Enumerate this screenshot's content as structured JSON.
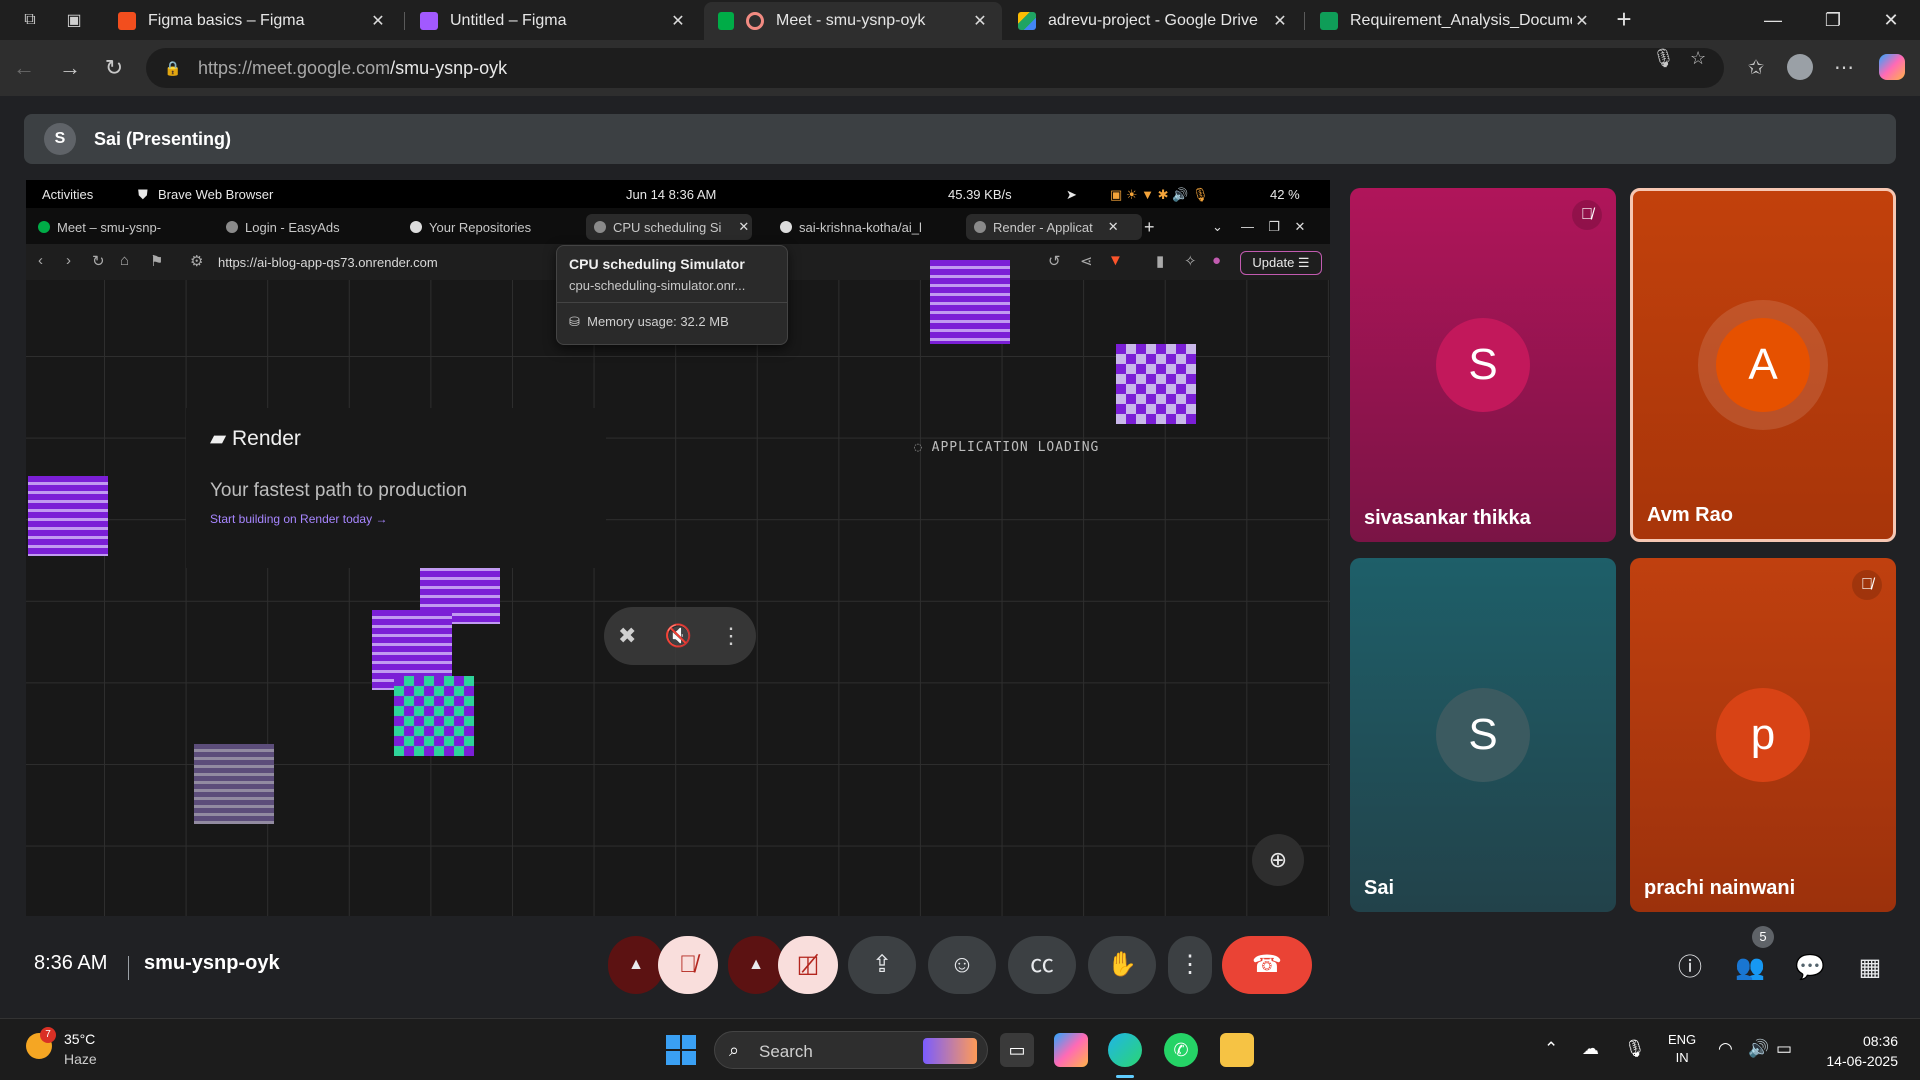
{
  "browser": {
    "tabs": [
      {
        "title": "Figma basics – Figma",
        "favicon": "figma-icon",
        "color": "#f24e1e"
      },
      {
        "title": "Untitled – Figma",
        "favicon": "figma-icon",
        "color": "#a259ff"
      },
      {
        "title": "Meet - smu-ysnp-oyk",
        "favicon": "meet-icon",
        "color": "#00ac47",
        "active": true
      },
      {
        "title": "adrevu-project - Google Drive",
        "favicon": "google-drive-icon",
        "color": "#1fa463"
      },
      {
        "title": "Requirement_Analysis_Document",
        "favicon": "google-sheets-icon",
        "color": "#0f9d58"
      }
    ],
    "url_host": "https://meet.google.com",
    "url_path": "/smu-ysnp-oyk"
  },
  "meet": {
    "presenter_initial": "S",
    "presenter_label": "Sai (Presenting)",
    "time": "8:36 AM",
    "meeting_code": "smu-ysnp-oyk",
    "participant_count": "5",
    "participants": [
      {
        "name": "sivasankar thikka",
        "initial": "S",
        "muted": true,
        "bg": "#b5195a",
        "avatar": "#c2185b"
      },
      {
        "name": "Avm Rao",
        "initial": "A",
        "muted": false,
        "bg": "#c2410c",
        "avatar": "#e65100"
      },
      {
        "name": "Sai",
        "initial": "S",
        "muted": false,
        "bg": "#1f5a63",
        "avatar": "#3c5a5f"
      },
      {
        "name": "prachi nainwani",
        "initial": "p",
        "muted": true,
        "bg": "#b83a0f",
        "avatar": "#d84315"
      }
    ]
  },
  "shared_screen": {
    "ubuntu": {
      "activities": "Activities",
      "app": "Brave Web Browser",
      "datetime": "Jun 14  8:36 AM",
      "net": "45.39 KB/s",
      "battery": "42 %"
    },
    "tabs": [
      "Meet – smu-ysnp-",
      "Login - EasyAds",
      "Your Repositories",
      "CPU scheduling Si",
      "sai-krishna-kotha/ai_l",
      "Render - Applicat"
    ],
    "url": "https://ai-blog-app-qs73.onrender.com",
    "update": "Update",
    "tooltip": {
      "title": "CPU scheduling Simulator",
      "url": "cpu-scheduling-simulator.onr...",
      "memory": "Memory usage: 32.2 MB"
    },
    "render": {
      "logo": "Render",
      "tagline": "Your fastest path to production",
      "link": "Start building on Render today →",
      "loading": "APPLICATION LOADING"
    }
  },
  "taskbar": {
    "temp": "35°C",
    "weather": "Haze",
    "weather_badge": "7",
    "search": "Search",
    "lang1": "ENG",
    "lang2": "IN",
    "time": "08:36",
    "date": "14-06-2025"
  }
}
